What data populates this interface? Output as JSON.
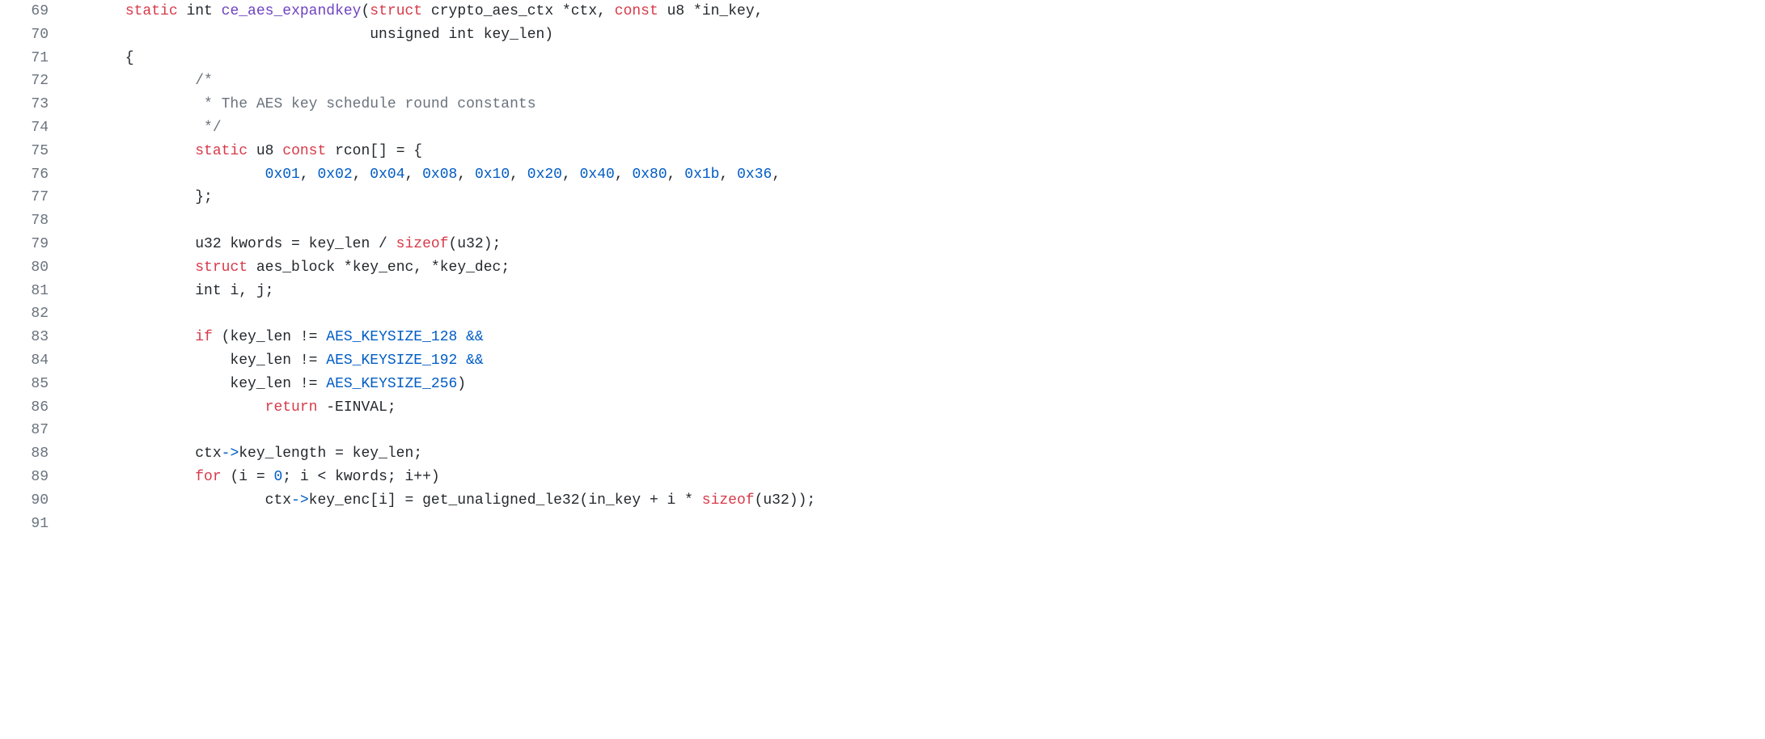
{
  "lines": [
    {
      "num": "69",
      "tokens": [
        {
          "t": "      ",
          "c": ""
        },
        {
          "t": "static",
          "c": "keyword-storage"
        },
        {
          "t": " ",
          "c": ""
        },
        {
          "t": "int",
          "c": "keyword-type"
        },
        {
          "t": " ",
          "c": ""
        },
        {
          "t": "ce_aes_expandkey",
          "c": "function-name"
        },
        {
          "t": "(",
          "c": "paren"
        },
        {
          "t": "struct",
          "c": "keyword-struct"
        },
        {
          "t": " crypto_aes_ctx ",
          "c": ""
        },
        {
          "t": "*",
          "c": ""
        },
        {
          "t": "ctx, ",
          "c": ""
        },
        {
          "t": "const",
          "c": "keyword-const"
        },
        {
          "t": " u8 ",
          "c": ""
        },
        {
          "t": "*",
          "c": ""
        },
        {
          "t": "in_key,",
          "c": ""
        }
      ]
    },
    {
      "num": "70",
      "tokens": [
        {
          "t": "                                  unsigned ",
          "c": ""
        },
        {
          "t": "int",
          "c": "keyword-type"
        },
        {
          "t": " key_len)",
          "c": ""
        }
      ]
    },
    {
      "num": "71",
      "tokens": [
        {
          "t": "      {",
          "c": ""
        }
      ]
    },
    {
      "num": "72",
      "tokens": [
        {
          "t": "              ",
          "c": ""
        },
        {
          "t": "/*",
          "c": "comment"
        }
      ]
    },
    {
      "num": "73",
      "tokens": [
        {
          "t": "               ",
          "c": ""
        },
        {
          "t": "* The AES key schedule round constants",
          "c": "comment"
        }
      ]
    },
    {
      "num": "74",
      "tokens": [
        {
          "t": "               ",
          "c": ""
        },
        {
          "t": "*/",
          "c": "comment"
        }
      ]
    },
    {
      "num": "75",
      "tokens": [
        {
          "t": "              ",
          "c": ""
        },
        {
          "t": "static",
          "c": "keyword-storage"
        },
        {
          "t": " u8 ",
          "c": ""
        },
        {
          "t": "const",
          "c": "keyword-const"
        },
        {
          "t": " rcon[] = {",
          "c": ""
        }
      ]
    },
    {
      "num": "76",
      "tokens": [
        {
          "t": "                      ",
          "c": ""
        },
        {
          "t": "0x01",
          "c": "number"
        },
        {
          "t": ", ",
          "c": ""
        },
        {
          "t": "0x02",
          "c": "number"
        },
        {
          "t": ", ",
          "c": ""
        },
        {
          "t": "0x04",
          "c": "number"
        },
        {
          "t": ", ",
          "c": ""
        },
        {
          "t": "0x08",
          "c": "number"
        },
        {
          "t": ", ",
          "c": ""
        },
        {
          "t": "0x10",
          "c": "number"
        },
        {
          "t": ", ",
          "c": ""
        },
        {
          "t": "0x20",
          "c": "number"
        },
        {
          "t": ", ",
          "c": ""
        },
        {
          "t": "0x40",
          "c": "number"
        },
        {
          "t": ", ",
          "c": ""
        },
        {
          "t": "0x80",
          "c": "number"
        },
        {
          "t": ", ",
          "c": ""
        },
        {
          "t": "0x1b",
          "c": "number"
        },
        {
          "t": ", ",
          "c": ""
        },
        {
          "t": "0x36",
          "c": "number"
        },
        {
          "t": ",",
          "c": ""
        }
      ]
    },
    {
      "num": "77",
      "tokens": [
        {
          "t": "              };",
          "c": ""
        }
      ]
    },
    {
      "num": "78",
      "tokens": [
        {
          "t": "",
          "c": ""
        }
      ]
    },
    {
      "num": "79",
      "tokens": [
        {
          "t": "              u32 kwords = key_len / ",
          "c": ""
        },
        {
          "t": "sizeof",
          "c": "sizeof-kw"
        },
        {
          "t": "(u32);",
          "c": ""
        }
      ]
    },
    {
      "num": "80",
      "tokens": [
        {
          "t": "              ",
          "c": ""
        },
        {
          "t": "struct",
          "c": "keyword-struct"
        },
        {
          "t": " aes_block ",
          "c": ""
        },
        {
          "t": "*",
          "c": ""
        },
        {
          "t": "key_enc, ",
          "c": ""
        },
        {
          "t": "*",
          "c": ""
        },
        {
          "t": "key_dec;",
          "c": ""
        }
      ]
    },
    {
      "num": "81",
      "tokens": [
        {
          "t": "              ",
          "c": ""
        },
        {
          "t": "int",
          "c": "keyword-type"
        },
        {
          "t": " i, j;",
          "c": ""
        }
      ]
    },
    {
      "num": "82",
      "tokens": [
        {
          "t": "",
          "c": ""
        }
      ]
    },
    {
      "num": "83",
      "tokens": [
        {
          "t": "              ",
          "c": ""
        },
        {
          "t": "if",
          "c": "keyword-control"
        },
        {
          "t": " (key_len != ",
          "c": ""
        },
        {
          "t": "AES_KEYSIZE_128",
          "c": "constant"
        },
        {
          "t": " ",
          "c": ""
        },
        {
          "t": "&&",
          "c": "constant"
        }
      ]
    },
    {
      "num": "84",
      "tokens": [
        {
          "t": "                  key_len != ",
          "c": ""
        },
        {
          "t": "AES_KEYSIZE_192",
          "c": "constant"
        },
        {
          "t": " ",
          "c": ""
        },
        {
          "t": "&&",
          "c": "constant"
        }
      ]
    },
    {
      "num": "85",
      "tokens": [
        {
          "t": "                  key_len != ",
          "c": ""
        },
        {
          "t": "AES_KEYSIZE_256",
          "c": "constant"
        },
        {
          "t": ")",
          "c": ""
        }
      ]
    },
    {
      "num": "86",
      "tokens": [
        {
          "t": "                      ",
          "c": ""
        },
        {
          "t": "return",
          "c": "keyword-return"
        },
        {
          "t": " -EINVAL;",
          "c": ""
        }
      ]
    },
    {
      "num": "87",
      "tokens": [
        {
          "t": "",
          "c": ""
        }
      ]
    },
    {
      "num": "88",
      "tokens": [
        {
          "t": "              ctx",
          "c": ""
        },
        {
          "t": "->",
          "c": "operator-arrow"
        },
        {
          "t": "key_length = key_len;",
          "c": ""
        }
      ]
    },
    {
      "num": "89",
      "tokens": [
        {
          "t": "              ",
          "c": ""
        },
        {
          "t": "for",
          "c": "keyword-control"
        },
        {
          "t": " (i = ",
          "c": ""
        },
        {
          "t": "0",
          "c": "number"
        },
        {
          "t": "; i < kwords; i++)",
          "c": ""
        }
      ]
    },
    {
      "num": "90",
      "tokens": [
        {
          "t": "                      ctx",
          "c": ""
        },
        {
          "t": "->",
          "c": "operator-arrow"
        },
        {
          "t": "key_enc[i] = ",
          "c": ""
        },
        {
          "t": "get_unaligned_le32",
          "c": "func-call"
        },
        {
          "t": "(in_key + i * ",
          "c": ""
        },
        {
          "t": "sizeof",
          "c": "sizeof-kw"
        },
        {
          "t": "(u32));",
          "c": ""
        }
      ]
    },
    {
      "num": "91",
      "tokens": [
        {
          "t": "",
          "c": ""
        }
      ]
    }
  ]
}
